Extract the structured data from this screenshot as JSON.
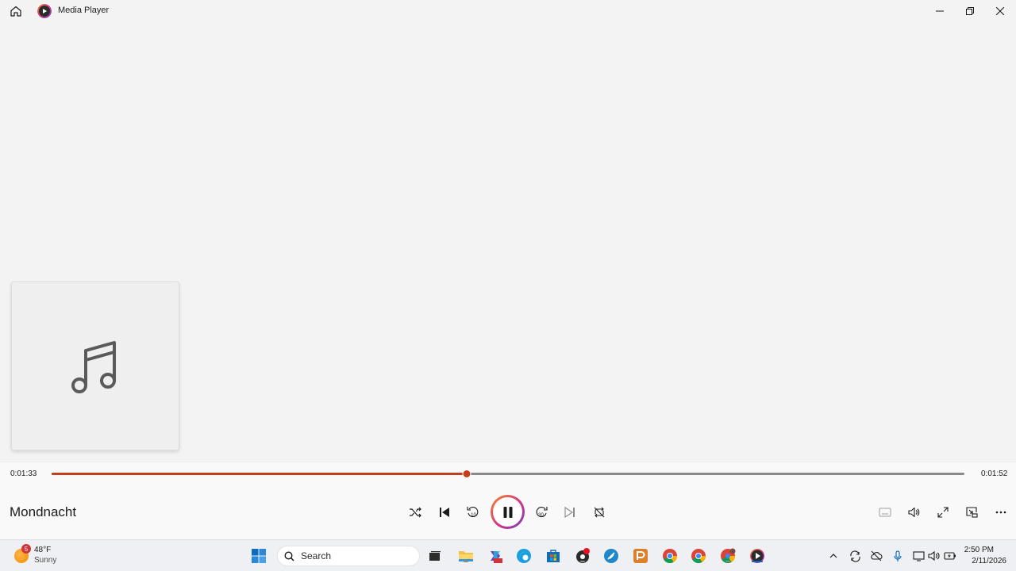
{
  "window": {
    "title": "Media Player",
    "minimize_icon": "minimize-icon",
    "maximize_icon": "restore-icon",
    "close_icon": "close-icon"
  },
  "album_art": {
    "icon": "music-note-icon"
  },
  "player": {
    "elapsed": "0:01:33",
    "duration": "0:01:52",
    "progress": 0.455,
    "track_title": "Mondnacht",
    "accent_color": "#c43e1c",
    "skip_back_label": "10",
    "skip_forward_label": "30"
  },
  "taskbar": {
    "weather": {
      "temp": "48°F",
      "condition": "Sunny",
      "badge": "5"
    },
    "search_placeholder": "Search",
    "clock": {
      "time": "2:50 PM",
      "date": "2/11/2026"
    }
  }
}
